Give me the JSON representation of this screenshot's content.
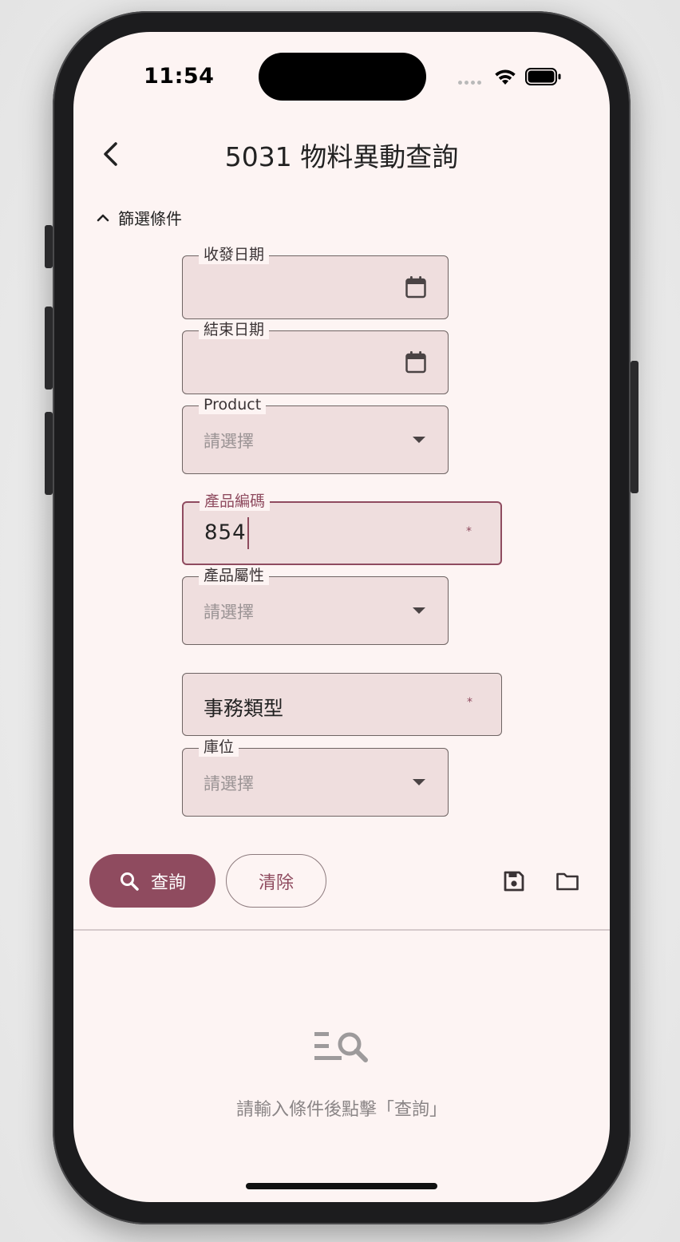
{
  "status_bar": {
    "time": "11:54"
  },
  "header": {
    "title": "5031 物料異動查詢"
  },
  "filter": {
    "toggle_label": "篩選條件",
    "fields": {
      "receive_date": {
        "label": "收發日期",
        "value": ""
      },
      "end_date": {
        "label": "結束日期",
        "value": ""
      },
      "product": {
        "label": "Product",
        "placeholder": "請選擇"
      },
      "product_code": {
        "label": "產品編碼",
        "value": "854",
        "required_mark": "*"
      },
      "product_attr": {
        "label": "產品屬性",
        "placeholder": "請選擇"
      },
      "transaction_type": {
        "text": "事務類型",
        "required_mark": "*"
      },
      "location": {
        "label": "庫位",
        "placeholder": "請選擇"
      }
    }
  },
  "actions": {
    "query_label": "查詢",
    "clear_label": "清除"
  },
  "empty_state": {
    "message": "請輸入條件後點擊「查詢」"
  },
  "colors": {
    "primary": "#8f4b5f",
    "background": "#fdf4f3",
    "field_fill": "#efdede"
  }
}
